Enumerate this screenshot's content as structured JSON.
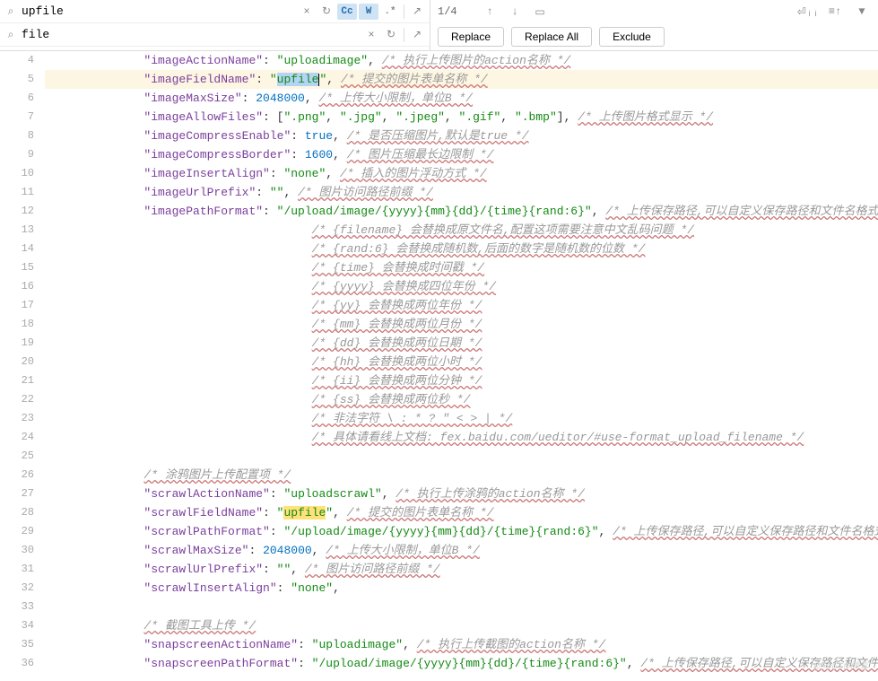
{
  "search": {
    "find_value": "upfile",
    "replace_value": "file",
    "count": "1/4"
  },
  "toggles": {
    "cc": "Cc",
    "w": "W",
    "regex": ".*"
  },
  "buttons": {
    "replace": "Replace",
    "replace_all": "Replace All",
    "exclude": "Exclude"
  },
  "gutter_start": 4,
  "code_lines": [
    {
      "n": 4,
      "indent": 2,
      "key": "imageActionName",
      "val": "uploadimage",
      "punc": ",",
      "cmt": "/* 执行上传图片的action名称 */"
    },
    {
      "n": 5,
      "indent": 2,
      "key": "imageFieldName",
      "val": "upfile",
      "punc": ",",
      "cmt": "/* 提交的图片表单名称 */",
      "sel": true,
      "current": true
    },
    {
      "n": 6,
      "indent": 2,
      "key": "imageMaxSize",
      "num": "2048000",
      "punc": ",",
      "cmt": "/* 上传大小限制，单位B */"
    },
    {
      "n": 7,
      "indent": 2,
      "key": "imageAllowFiles",
      "arr": [
        "\".png\"",
        "\".jpg\"",
        "\".jpeg\"",
        "\".gif\"",
        "\".bmp\""
      ],
      "punc": ",",
      "cmt": "/* 上传图片格式显示 */"
    },
    {
      "n": 8,
      "indent": 2,
      "key": "imageCompressEnable",
      "bool": "true",
      "punc": ",",
      "cmt": "/* 是否压缩图片,默认是true */"
    },
    {
      "n": 9,
      "indent": 2,
      "key": "imageCompressBorder",
      "num": "1600",
      "punc": ",",
      "cmt": "/* 图片压缩最长边限制 */"
    },
    {
      "n": 10,
      "indent": 2,
      "key": "imageInsertAlign",
      "val": "none",
      "punc": ",",
      "cmt": "/* 插入的图片浮动方式 */"
    },
    {
      "n": 11,
      "indent": 2,
      "key": "imageUrlPrefix",
      "val": "",
      "punc": ",",
      "cmt": "/* 图片访问路径前缀 */"
    },
    {
      "n": 12,
      "indent": 2,
      "key": "imagePathFormat",
      "val": "/upload/image/{yyyy}{mm}{dd}/{time}{rand:6}",
      "punc": ",",
      "cmt": "/* 上传保存路径,可以自定义保存路径和文件名格式 */"
    },
    {
      "n": 13,
      "indent": 8,
      "cmt": "/* {filename} 会替换成原文件名,配置这项需要注意中文乱码问题 */"
    },
    {
      "n": 14,
      "indent": 8,
      "cmt": "/* {rand:6} 会替换成随机数,后面的数字是随机数的位数 */"
    },
    {
      "n": 15,
      "indent": 8,
      "cmt": "/* {time} 会替换成时间戳 */"
    },
    {
      "n": 16,
      "indent": 8,
      "cmt": "/* {yyyy} 会替换成四位年份 */"
    },
    {
      "n": 17,
      "indent": 8,
      "cmt": "/* {yy} 会替换成两位年份 */"
    },
    {
      "n": 18,
      "indent": 8,
      "cmt": "/* {mm} 会替换成两位月份 */"
    },
    {
      "n": 19,
      "indent": 8,
      "cmt": "/* {dd} 会替换成两位日期 */"
    },
    {
      "n": 20,
      "indent": 8,
      "cmt": "/* {hh} 会替换成两位小时 */"
    },
    {
      "n": 21,
      "indent": 8,
      "cmt": "/* {ii} 会替换成两位分钟 */"
    },
    {
      "n": 22,
      "indent": 8,
      "cmt": "/* {ss} 会替换成两位秒 */"
    },
    {
      "n": 23,
      "indent": 8,
      "cmt": "/* 非法字符 \\ : * ? \" < > | */"
    },
    {
      "n": 24,
      "indent": 8,
      "cmt": "/* 具体请看线上文档: fex.baidu.com/ueditor/#use-format_upload_filename */"
    },
    {
      "n": 25,
      "indent": 0
    },
    {
      "n": 26,
      "indent": 2,
      "cmt": "/* 涂鸦图片上传配置项 */"
    },
    {
      "n": 27,
      "indent": 2,
      "key": "scrawlActionName",
      "val": "uploadscrawl",
      "punc": ",",
      "cmt": "/* 执行上传涂鸦的action名称 */"
    },
    {
      "n": 28,
      "indent": 2,
      "key": "scrawlFieldName",
      "val": "upfile",
      "punc": ",",
      "cmt": "/* 提交的图片表单名称 */",
      "match": true
    },
    {
      "n": 29,
      "indent": 2,
      "key": "scrawlPathFormat",
      "val": "/upload/image/{yyyy}{mm}{dd}/{time}{rand:6}",
      "punc": ",",
      "cmt": "/* 上传保存路径,可以自定义保存路径和文件名格式 */"
    },
    {
      "n": 30,
      "indent": 2,
      "key": "scrawlMaxSize",
      "num": "2048000",
      "punc": ",",
      "cmt": "/* 上传大小限制，单位B */"
    },
    {
      "n": 31,
      "indent": 2,
      "key": "scrawlUrlPrefix",
      "val": "",
      "punc": ",",
      "cmt": "/* 图片访问路径前缀 */"
    },
    {
      "n": 32,
      "indent": 2,
      "key": "scrawlInsertAlign",
      "val": "none",
      "punc": ","
    },
    {
      "n": 33,
      "indent": 0
    },
    {
      "n": 34,
      "indent": 2,
      "cmt": "/* 截图工具上传 */"
    },
    {
      "n": 35,
      "indent": 2,
      "key": "snapscreenActionName",
      "val": "uploadimage",
      "punc": ",",
      "cmt": "/* 执行上传截图的action名称 */"
    },
    {
      "n": 36,
      "indent": 2,
      "key": "snapscreenPathFormat",
      "val": "/upload/image/{yyyy}{mm}{dd}/{time}{rand:6}",
      "punc": ",",
      "cmt": "/* 上传保存路径,可以自定义保存路径和文件名格式 */"
    }
  ]
}
